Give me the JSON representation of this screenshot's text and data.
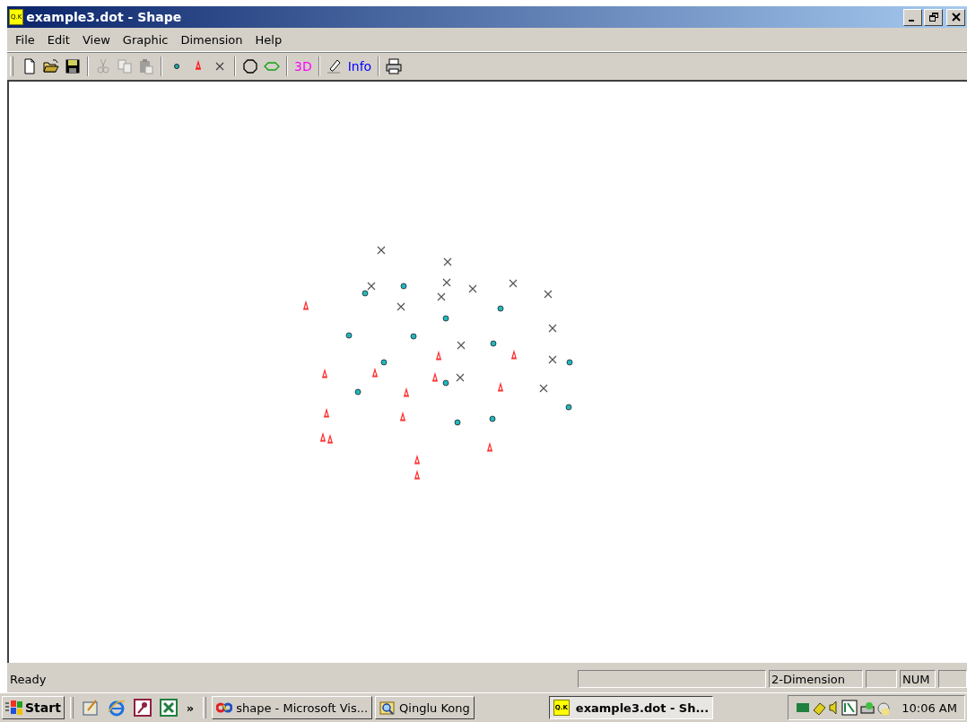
{
  "window": {
    "title": "example3.dot - Shape",
    "icon_label": "Q.K"
  },
  "menu": [
    "File",
    "Edit",
    "View",
    "Graphic",
    "Dimension",
    "Help"
  ],
  "toolbar": [
    {
      "kind": "new",
      "disabled": false
    },
    {
      "kind": "open",
      "disabled": false
    },
    {
      "kind": "save",
      "disabled": false
    },
    {
      "kind": "separator"
    },
    {
      "kind": "cut",
      "disabled": true
    },
    {
      "kind": "copy",
      "disabled": true
    },
    {
      "kind": "paste",
      "disabled": true
    },
    {
      "kind": "separator"
    },
    {
      "kind": "dot",
      "disabled": false
    },
    {
      "kind": "cone",
      "disabled": false
    },
    {
      "kind": "cross",
      "disabled": false
    },
    {
      "kind": "separator"
    },
    {
      "kind": "circle",
      "disabled": false
    },
    {
      "kind": "ellipse",
      "disabled": false
    },
    {
      "kind": "separator"
    },
    {
      "kind": "text",
      "label": "3D",
      "color": "#ff00ff",
      "disabled": false
    },
    {
      "kind": "separator"
    },
    {
      "kind": "eraser",
      "disabled": false
    },
    {
      "kind": "text",
      "label": "Info",
      "color": "#0000ff",
      "disabled": false
    },
    {
      "kind": "separator"
    },
    {
      "kind": "print",
      "disabled": false
    }
  ],
  "status_bar": {
    "message": "Ready",
    "mode": "2-Dimension",
    "num_lock": "NUM"
  },
  "taskbar": {
    "start": "Start",
    "quick_launch": [
      {
        "kind": "notepad"
      },
      {
        "kind": "browser"
      },
      {
        "kind": "key"
      },
      {
        "kind": "sheet"
      }
    ],
    "more": "»",
    "tasks": [
      {
        "kind": "studio",
        "label": "shape - Microsoft Vis...",
        "selected": false
      },
      {
        "kind": "search",
        "label": "Qinglu Kong",
        "selected": false
      },
      {
        "kind": "app",
        "label": "example3.dot - Sh...",
        "icon_label": "Q.K",
        "selected": true
      }
    ],
    "clock": "10:06 AM"
  }
}
